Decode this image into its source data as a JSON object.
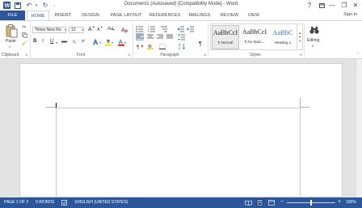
{
  "titlebar": {
    "title": "Document1 (Autosaved) [Compatibility Mode] - Word",
    "help": "?",
    "minimize": "—",
    "restore": "❐",
    "close": "✕"
  },
  "tabs": [
    "FILE",
    "HOME",
    "INSERT",
    "DESIGN",
    "PAGE LAYOUT",
    "REFERENCES",
    "MAILINGS",
    "REVIEW",
    "VIEW"
  ],
  "signin": "Sign in",
  "clipboard": {
    "paste": "Paste",
    "label": "Clipboard"
  },
  "font": {
    "name": "Times New Ro",
    "size": "12",
    "grow": "A",
    "shrink": "A",
    "case": "Aa",
    "bold": "B",
    "italic": "I",
    "underline": "U",
    "strike": "abc",
    "subscript": "x₂",
    "superscript": "x²",
    "label": "Font"
  },
  "paragraph": {
    "pilcrow": "¶",
    "label": "Paragraph"
  },
  "styles": {
    "items": [
      {
        "sample": "AaBbCcI",
        "name": "¶ Normal"
      },
      {
        "sample": "AaBbCcI",
        "name": "¶ No Spac..."
      },
      {
        "sample": "AaBbC",
        "name": "Heading 1"
      }
    ],
    "label": "Styles"
  },
  "editing": {
    "label": "Editing"
  },
  "status": {
    "page": "PAGE 1 OF 2",
    "words": "0 WORDS",
    "language": "ENGLISH (UNITED STATES)",
    "zoom": "100%",
    "zoom_level": 100,
    "minus": "−",
    "plus": "+"
  }
}
